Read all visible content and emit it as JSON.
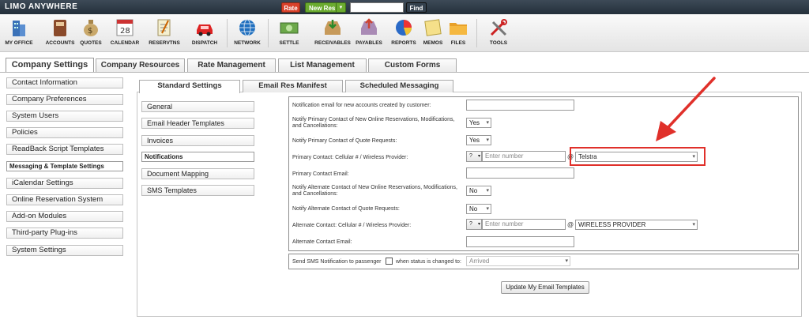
{
  "topbar": {
    "logo": "LIMO ANYWHERE",
    "rate_label": "Rate",
    "newres_label": "New Res",
    "search_value": "",
    "find_label": "Find"
  },
  "iconbar": {
    "items": [
      "MY OFFICE",
      "ACCOUNTS",
      "QUOTES",
      "CALENDAR",
      "RESERVTNS",
      "DISPATCH",
      "NETWORK",
      "SETTLE",
      "RECEIVABLES",
      "PAYABLES",
      "REPORTS",
      "MEMOS",
      "FILES",
      "TOOLS"
    ],
    "calendar_day": "28"
  },
  "company_tabs": [
    "Company Settings",
    "Company Resources",
    "Rate Management",
    "List Management",
    "Custom Forms"
  ],
  "left_nav": [
    "Contact Information",
    "Company Preferences",
    "System Users",
    "Policies",
    "ReadBack Script Templates",
    "Messaging & Template Settings",
    "iCalendar Settings",
    "Online Reservation System",
    "Add-on Modules",
    "Third-party Plug-ins",
    "System Settings"
  ],
  "settings_tabs": [
    "Standard Settings",
    "Email Res Manifest",
    "Scheduled Messaging"
  ],
  "sub_nav": [
    "General",
    "Email Header Templates",
    "Invoices",
    "Notifications",
    "Document Mapping",
    "SMS Templates"
  ],
  "form": {
    "labels": {
      "notif_email": "Notification email for new accounts created by customer:",
      "notify_primary_res": "Notify Primary Contact of New Online Reservations, Modifications, and Cancellations:",
      "notify_primary_quote": "Notify Primary Contact of Quote Requests:",
      "primary_cell": "Primary Contact: Cellular # / Wireless Provider:",
      "primary_email": "Primary Contact Email:",
      "notify_alt_res": "Notify Alternate Contact of New Online Reservations, Modifications, and Cancellations:",
      "notify_alt_quote": "Notify Alternate Contact of Quote Requests:",
      "alt_cell": "Alternate Contact: Cellular # / Wireless Provider:",
      "alt_email": "Alternate Contact Email:",
      "sms_notif": "Send SMS Notification to passenger",
      "sms_status": "when status is changed to:"
    },
    "values": {
      "notify_primary_res": "Yes",
      "notify_primary_quote": "Yes",
      "primary_cc": "?",
      "primary_number_placeholder": "Enter number",
      "primary_provider": "Telstra",
      "notify_alt_res": "No",
      "notify_alt_quote": "No",
      "alt_cc": "?",
      "alt_number_placeholder": "Enter number",
      "alt_provider": "WIRELESS PROVIDER",
      "sms_status": "Arrived",
      "at_sign": "@"
    },
    "update_button": "Update My Email Templates"
  },
  "colors": {
    "annotation_red": "#e0302a",
    "topbar": "#2b3742"
  }
}
